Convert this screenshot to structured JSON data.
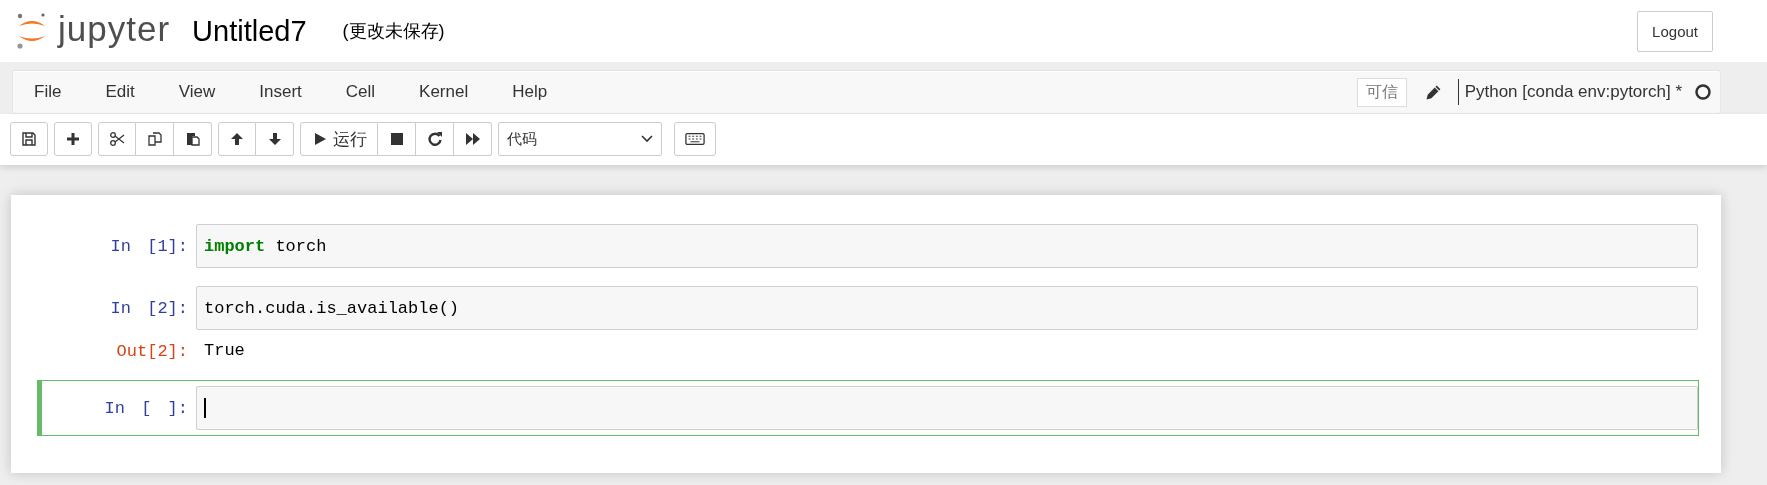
{
  "header": {
    "brand": "jupyter",
    "title": "Untitled7",
    "save_status": "(更改未保存)",
    "logout": "Logout"
  },
  "menu": [
    "File",
    "Edit",
    "View",
    "Insert",
    "Cell",
    "Kernel",
    "Help"
  ],
  "notebook_status": {
    "trusted": "可信",
    "edit_mode": true,
    "kernel": "Python [conda env:pytorch] *",
    "kernel_busy": false
  },
  "toolbar": {
    "run_label": "运行",
    "cell_type": "代码"
  },
  "cells": [
    {
      "prompt": "In [1]:",
      "tokens": [
        {
          "text": "import",
          "kind": "keyword"
        },
        {
          "text": " torch",
          "kind": "plain"
        }
      ],
      "selected": false
    },
    {
      "prompt": "In [2]:",
      "tokens": [
        {
          "text": "torch.cuda.is_available()",
          "kind": "plain"
        }
      ],
      "output_prompt": "Out[2]:",
      "output": "True",
      "selected": false
    },
    {
      "prompt": "In [ ]:",
      "selected": true
    }
  ]
}
